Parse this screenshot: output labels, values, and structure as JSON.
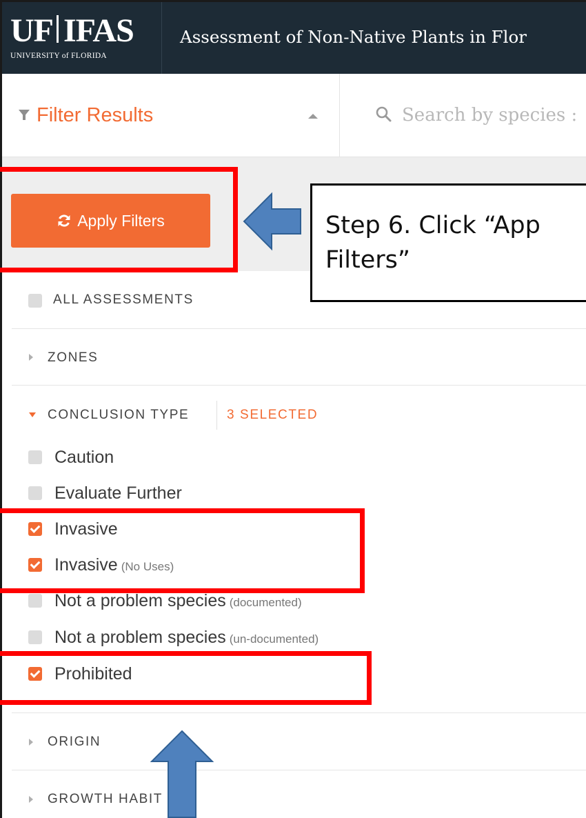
{
  "header": {
    "logo_main_left": "UF",
    "logo_main_right": "IFAS",
    "logo_sub": "UNIVERSITY of FLORIDA",
    "app_title": "Assessment of Non-Native Plants in Flor"
  },
  "filter_bar": {
    "title": "Filter Results",
    "search_placeholder": "Search by species :"
  },
  "panel": {
    "apply_label": "Apply Filters",
    "all_assessments": "ALL ASSESSMENTS",
    "zones": "ZONES",
    "conclusion_type": {
      "label": "CONCLUSION TYPE",
      "selected": "3 SELECTED",
      "options": [
        {
          "label": "Caution",
          "note": "",
          "checked": false
        },
        {
          "label": "Evaluate Further",
          "note": "",
          "checked": false
        },
        {
          "label": "Invasive",
          "note": "",
          "checked": true
        },
        {
          "label": "Invasive",
          "note": "(No Uses)",
          "checked": true
        },
        {
          "label": "Not a problem species",
          "note": "(documented)",
          "checked": false
        },
        {
          "label": "Not a problem species",
          "note": "(un-documented)",
          "checked": false
        },
        {
          "label": "Prohibited",
          "note": "",
          "checked": true
        }
      ]
    },
    "origin": "ORIGIN",
    "growth_habit": "GROWTH HABIT"
  },
  "annotation": {
    "callout_text": "Step 6. Click “App\nFilters”"
  },
  "colors": {
    "header_bg": "#1d2b36",
    "accent": "#f26b33",
    "highlight": "#ff0000",
    "arrow": "#4f81bd"
  },
  "icons": {
    "filter": "funnel-icon",
    "collapse": "caret-up-icon",
    "search": "search-icon",
    "apply": "refresh-icon",
    "expand": "caret-right-icon",
    "expanded": "caret-down-icon"
  }
}
